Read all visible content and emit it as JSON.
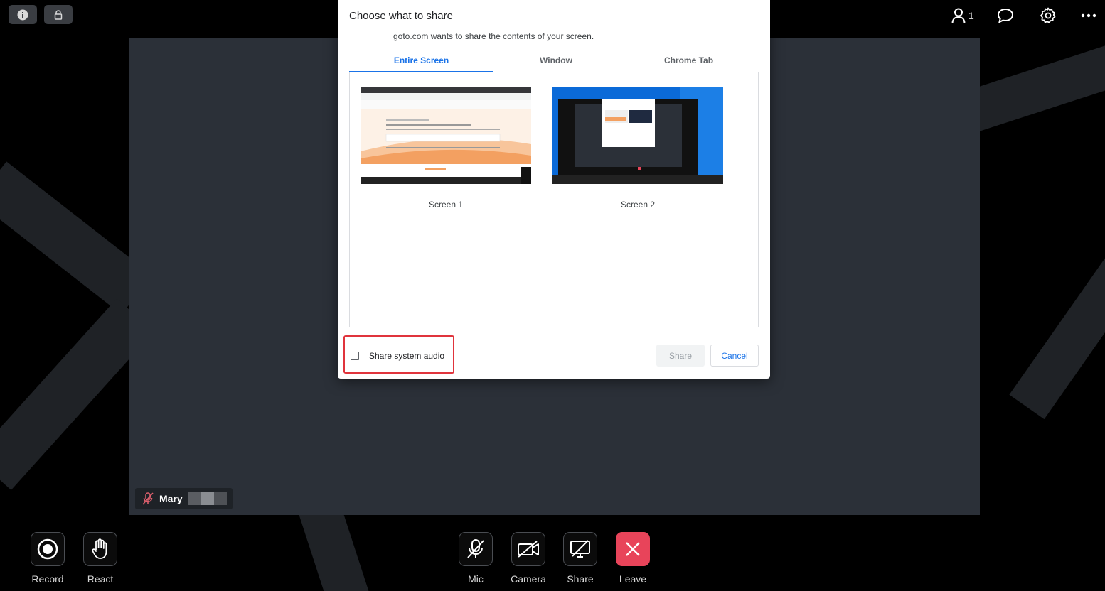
{
  "topbar": {
    "info_button": "info-icon",
    "lock_button": "lock-icon",
    "participants_count": "1"
  },
  "dialog": {
    "title": "Choose what to share",
    "subtitle": "goto.com wants to share the contents of your screen.",
    "tabs": [
      {
        "label": "Entire Screen",
        "active": true
      },
      {
        "label": "Window",
        "active": false
      },
      {
        "label": "Chrome Tab",
        "active": false
      }
    ],
    "screens": [
      {
        "label": "Screen 1"
      },
      {
        "label": "Screen 2"
      }
    ],
    "share_audio_label": "Share system audio",
    "share_audio_checked": false,
    "share_button": "Share",
    "cancel_button": "Cancel"
  },
  "participant": {
    "name": "Mary"
  },
  "controls": {
    "record": "Record",
    "react": "React",
    "mic": "Mic",
    "camera": "Camera",
    "share": "Share",
    "leave": "Leave"
  },
  "colors": {
    "accent": "#1a73e8",
    "leave": "#e8445a",
    "highlight": "#e0343c",
    "stage": "#2b3038"
  }
}
